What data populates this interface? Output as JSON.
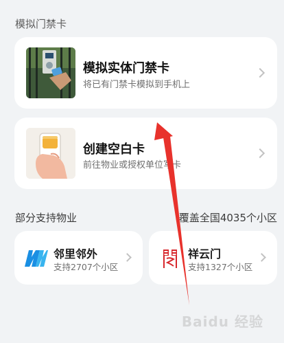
{
  "colors": {
    "background": "#f1f3f5",
    "card": "#ffffff",
    "accent_blue": "#1a8fe3",
    "accent_red": "#d7262b",
    "annotation_red": "#e8322c"
  },
  "section_sim": {
    "title": "模拟门禁卡"
  },
  "cards": {
    "simulate": {
      "title": "模拟实体门禁卡",
      "subtitle": "将已有门禁卡模拟到手机上",
      "icon": "gate-reader-photo"
    },
    "blank": {
      "title": "创建空白卡",
      "subtitle": "前往物业或授权单位写卡",
      "icon": "hand-holding-phone-icon"
    }
  },
  "section_property": {
    "title": "部分支持物业",
    "coverage": "覆盖全国4035个小区"
  },
  "partners": [
    {
      "name": "邻里邻外",
      "count": "支持2707个小区",
      "icon": "linli-logo"
    },
    {
      "name": "祥云门",
      "count": "支持1327个小区",
      "icon": "xiangyun-logo"
    }
  ],
  "watermark": "Baidu 经验"
}
